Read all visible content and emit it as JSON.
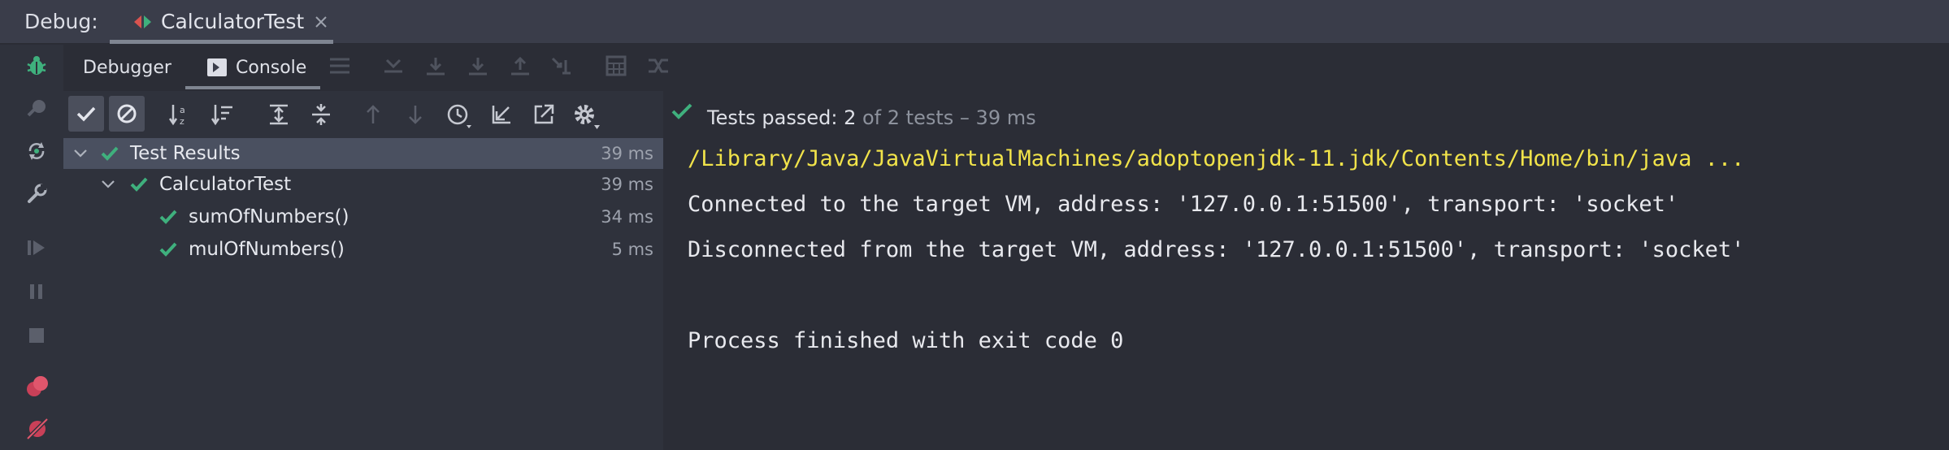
{
  "top": {
    "debug_label": "Debug:",
    "run_tab_label": "CalculatorTest"
  },
  "tool_tabs": {
    "debugger": "Debugger",
    "console": "Console"
  },
  "tree": {
    "rows": [
      {
        "label": "Test Results",
        "duration": "39 ms"
      },
      {
        "label": "CalculatorTest",
        "duration": "39 ms"
      },
      {
        "label": "sumOfNumbers()",
        "duration": "34 ms"
      },
      {
        "label": "mulOfNumbers()",
        "duration": "5 ms"
      }
    ]
  },
  "status": {
    "passed_label": "Tests passed:",
    "passed_count": "2",
    "of_total": "of 2 tests",
    "dash": "–",
    "total_time": "39 ms"
  },
  "console": {
    "lines": [
      "/Library/Java/JavaVirtualMachines/adoptopenjdk-11.jdk/Contents/Home/bin/java ...",
      "Connected to the target VM, address: '127.0.0.1:51500', transport: 'socket'",
      "Disconnected from the target VM, address: '127.0.0.1:51500', transport: 'socket'",
      "Process finished with exit code 0"
    ]
  },
  "colors": {
    "pass_green": "#3fb07d",
    "path_yellow": "#f1e34a",
    "dim_text": "#8d929d",
    "selection": "#4a5060"
  },
  "icons": [
    "bug-icon",
    "snapshot-icon",
    "rerun-icon",
    "wrench-icon",
    "resume-icon",
    "pause-icon",
    "stop-icon",
    "breakpoints-icon",
    "mute-breakpoints-icon",
    "console-icon",
    "show-passed-icon",
    "show-ignored-icon",
    "sort-alpha-icon",
    "sort-duration-icon",
    "expand-all-icon",
    "collapse-all-icon",
    "prev-failed-icon",
    "next-failed-icon",
    "history-icon",
    "import-icon",
    "export-icon",
    "settings-icon",
    "check-icon"
  ]
}
